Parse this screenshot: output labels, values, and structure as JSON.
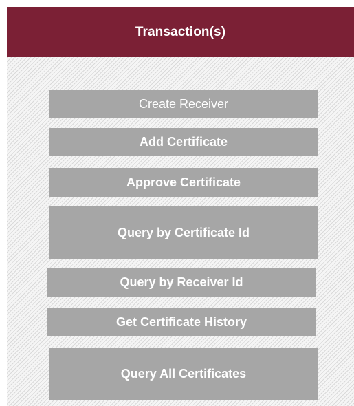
{
  "header": {
    "title": "Transaction(s)"
  },
  "buttons": [
    {
      "label": "Create Receiver"
    },
    {
      "label": "Add Certificate"
    },
    {
      "label": "Approve Certificate"
    },
    {
      "label": "Query by Certificate Id"
    },
    {
      "label": "Query by Receiver Id"
    },
    {
      "label": "Get Certificate History"
    },
    {
      "label": "Query All Certificates"
    }
  ],
  "colors": {
    "header_bg": "#7b2035",
    "button_bg": "#a6a6a6",
    "text_on_dark": "#ffffff"
  }
}
